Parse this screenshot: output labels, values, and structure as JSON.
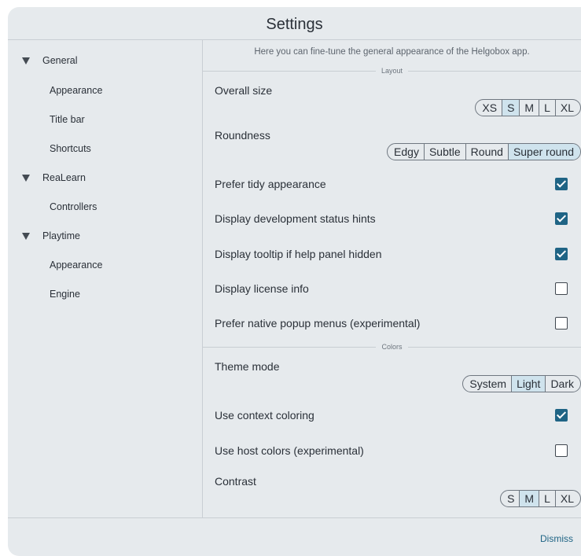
{
  "window": {
    "title": "Settings"
  },
  "sidebar": {
    "items": [
      {
        "label": "General",
        "expanded": true,
        "level": 0
      },
      {
        "label": "Appearance",
        "level": 1
      },
      {
        "label": "Title bar",
        "level": 1
      },
      {
        "label": "Shortcuts",
        "level": 1
      },
      {
        "label": "ReaLearn",
        "expanded": true,
        "level": 0
      },
      {
        "label": "Controllers",
        "level": 1
      },
      {
        "label": "Playtime",
        "expanded": true,
        "level": 0
      },
      {
        "label": "Appearance",
        "level": 1
      },
      {
        "label": "Engine",
        "level": 1
      }
    ]
  },
  "main": {
    "description": "Here you can fine-tune the general appearance of the Helgobox app.",
    "layout_section": {
      "title": "Layout",
      "overall_size": {
        "label": "Overall size",
        "options": [
          "XS",
          "S",
          "M",
          "L",
          "XL"
        ],
        "selected": "S"
      },
      "roundness": {
        "label": "Roundness",
        "options": [
          "Edgy",
          "Subtle",
          "Round",
          "Super round"
        ],
        "selected": "Super round"
      },
      "prefer_tidy": {
        "label": "Prefer tidy appearance",
        "checked": true
      },
      "dev_status_hints": {
        "label": "Display development status hints",
        "checked": true
      },
      "tooltip_hidden": {
        "label": "Display tooltip if help panel hidden",
        "checked": true
      },
      "license_info": {
        "label": "Display license info",
        "checked": false
      },
      "native_popup": {
        "label": "Prefer native popup menus (experimental)",
        "checked": false
      }
    },
    "colors_section": {
      "title": "Colors",
      "theme_mode": {
        "label": "Theme mode",
        "options": [
          "System",
          "Light",
          "Dark"
        ],
        "selected": "Light"
      },
      "context_coloring": {
        "label": "Use context coloring",
        "checked": true
      },
      "host_colors": {
        "label": "Use host colors (experimental)",
        "checked": false
      },
      "contrast": {
        "label": "Contrast",
        "options": [
          "S",
          "M",
          "L",
          "XL"
        ],
        "selected": "M"
      }
    }
  },
  "footer": {
    "dismiss_label": "Dismiss"
  },
  "colors": {
    "accent": "#1f6485",
    "selected_segment": "#cfe3ed",
    "background": "#e6eaed"
  }
}
